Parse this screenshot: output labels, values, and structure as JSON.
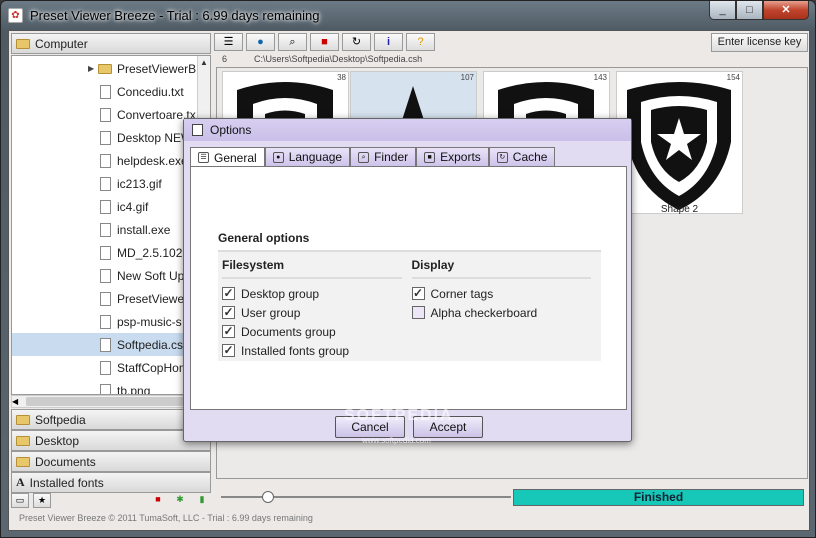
{
  "window": {
    "title": "Preset Viewer Breeze - Trial : 6.99 days remaining",
    "minimize": "_",
    "maximize": "□",
    "close": "✕"
  },
  "sidebar": {
    "root": "Computer",
    "tree": [
      {
        "label": "PresetViewerB",
        "type": "folder",
        "selected": false
      },
      {
        "label": "Concediu.txt",
        "type": "file",
        "selected": false
      },
      {
        "label": "Convertoare.tx",
        "type": "file",
        "selected": false
      },
      {
        "label": "Desktop NEW",
        "type": "file",
        "selected": false
      },
      {
        "label": "helpdesk.exe",
        "type": "file",
        "selected": false
      },
      {
        "label": "ic213.gif",
        "type": "file",
        "selected": false
      },
      {
        "label": "ic4.gif",
        "type": "file",
        "selected": false
      },
      {
        "label": "install.exe",
        "type": "file",
        "selected": false
      },
      {
        "label": "MD_2.5.102.",
        "type": "file",
        "selected": false
      },
      {
        "label": "New Soft Upd",
        "type": "file",
        "selected": false
      },
      {
        "label": "PresetViewer",
        "type": "file",
        "selected": false
      },
      {
        "label": "psp-music-s",
        "type": "file",
        "selected": false
      },
      {
        "label": "Softpedia.csh",
        "type": "file",
        "selected": true
      },
      {
        "label": "StaffCopHom",
        "type": "file",
        "selected": false
      },
      {
        "label": "tb.png",
        "type": "file",
        "selected": false
      }
    ],
    "groups": [
      "Softpedia",
      "Desktop",
      "Documents",
      "Installed fonts"
    ]
  },
  "toolbar": {
    "license_button": "Enter license key",
    "count": "6",
    "path": "C:\\Users\\Softpedia\\Desktop\\Softpedia.csh"
  },
  "thumbnails": [
    {
      "count": "38",
      "label": ""
    },
    {
      "count": "107",
      "label": ""
    },
    {
      "count": "143",
      "label": ""
    },
    {
      "count": "154",
      "label": "Shape 2"
    }
  ],
  "progress": {
    "label": "Finished",
    "value": 1.0
  },
  "zoom_slider": {
    "value": 0.15
  },
  "status": "Preset Viewer Breeze © 2011 TumaSoft, LLC - Trial : 6.99 days remaining",
  "dialog": {
    "title": "Options",
    "tabs": [
      "General",
      "Language",
      "Finder",
      "Exports",
      "Cache"
    ],
    "active_tab": "General",
    "section_title": "General options",
    "filesystem": {
      "heading": "Filesystem",
      "options": [
        {
          "label": "Desktop group",
          "checked": true
        },
        {
          "label": "User group",
          "checked": true
        },
        {
          "label": "Documents group",
          "checked": true
        },
        {
          "label": "Installed fonts group",
          "checked": true
        }
      ]
    },
    "display": {
      "heading": "Display",
      "options": [
        {
          "label": "Corner tags",
          "checked": true
        },
        {
          "label": "Alpha checkerboard",
          "checked": false
        }
      ]
    },
    "cancel": "Cancel",
    "accept": "Accept"
  },
  "watermark": {
    "logo": "SOFTPEDIA",
    "url": "www.softpedia.com"
  }
}
